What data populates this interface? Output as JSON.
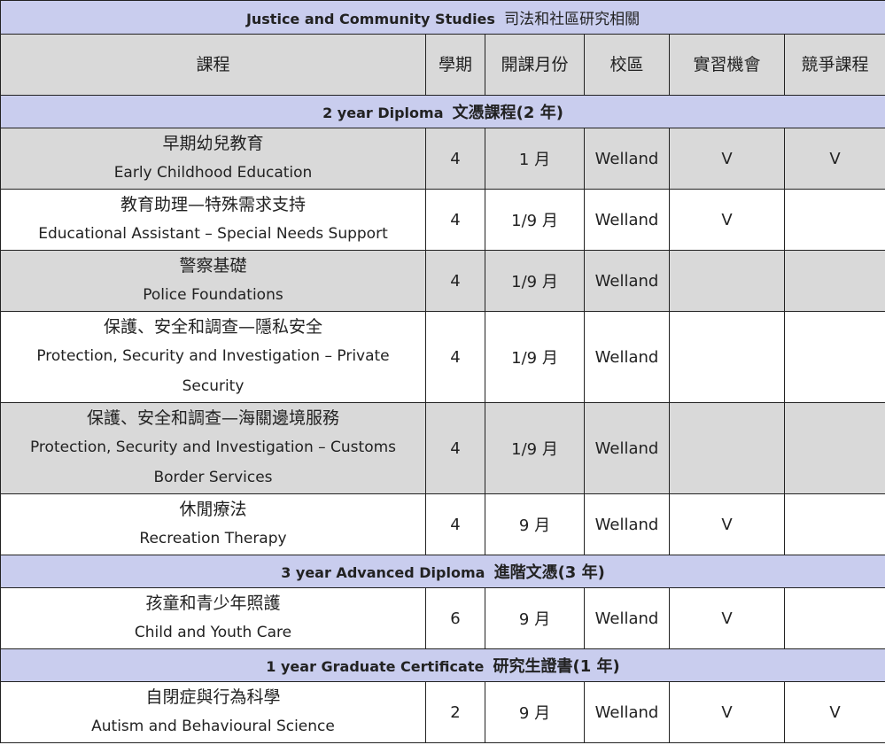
{
  "title": {
    "en": "Justice and Community Studies",
    "zh": "司法和社區研究相關"
  },
  "headers": {
    "program": "課程",
    "semesters": "學期",
    "start_month": "開課月份",
    "campus": "校區",
    "internship": "實習機會",
    "competitive": "競爭課程"
  },
  "sections": [
    {
      "label_en": "2 year Diploma",
      "label_zh": "文憑課程(2 年)",
      "rows": [
        {
          "zh": "早期幼兒教育",
          "en": "Early Childhood Education",
          "semesters": "4",
          "start": "1 月",
          "campus": "Welland",
          "internship": "V",
          "competitive": "V"
        },
        {
          "zh": "教育助理—特殊需求支持",
          "en": "Educational Assistant – Special Needs Support",
          "semesters": "4",
          "start": "1/9 月",
          "campus": "Welland",
          "internship": "V",
          "competitive": ""
        },
        {
          "zh": "警察基礎",
          "en": "Police Foundations",
          "semesters": "4",
          "start": "1/9 月",
          "campus": "Welland",
          "internship": "",
          "competitive": ""
        },
        {
          "zh": "保護、安全和調查—隱私安全",
          "en": "Protection, Security and Investigation – Private Security",
          "semesters": "4",
          "start": "1/9 月",
          "campus": "Welland",
          "internship": "",
          "competitive": ""
        },
        {
          "zh": "保護、安全和調查—海關邊境服務",
          "en": "Protection, Security and Investigation – Customs Border Services",
          "semesters": "4",
          "start": "1/9 月",
          "campus": "Welland",
          "internship": "",
          "competitive": ""
        },
        {
          "zh": "休閒療法",
          "en": "Recreation Therapy",
          "semesters": "4",
          "start": "9 月",
          "campus": "Welland",
          "internship": "V",
          "competitive": ""
        }
      ]
    },
    {
      "label_en": "3 year Advanced Diploma",
      "label_zh": "進階文憑(3 年)",
      "rows": [
        {
          "zh": "孩童和青少年照護",
          "en": "Child and Youth Care",
          "semesters": "6",
          "start": "9 月",
          "campus": "Welland",
          "internship": "V",
          "competitive": ""
        }
      ]
    },
    {
      "label_en": "1 year Graduate Certificate",
      "label_zh": "研究生證書(1 年)",
      "rows": [
        {
          "zh": "自閉症與行為科學",
          "en": "Autism and Behavioural Science",
          "semesters": "2",
          "start": "9 月",
          "campus": "Welland",
          "internship": "V",
          "competitive": "V"
        }
      ]
    }
  ]
}
